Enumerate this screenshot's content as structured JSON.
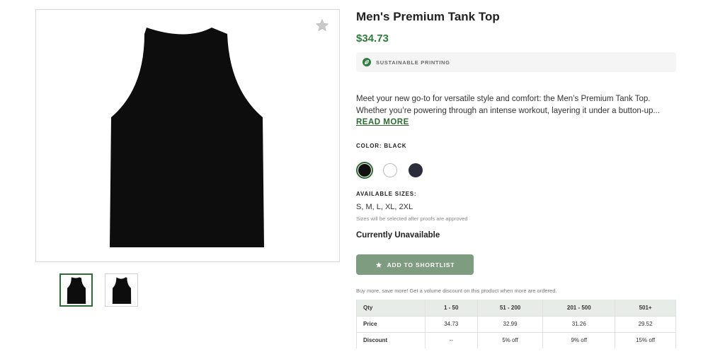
{
  "product": {
    "title": "Men's Premium Tank Top",
    "price": "$34.73",
    "badge": {
      "icon": "leaf-icon",
      "text": "SUSTAINABLE PRINTING"
    },
    "description_line1": "Meet your new go-to for versatile style and comfort: the Men’s Premium Tank Top.",
    "description_line2": "Whether you’re powering through an intense workout, layering it under a button-up...",
    "read_more": "READ MORE",
    "color_label": "COLOR: BLACK",
    "colors": [
      {
        "name": "Black",
        "hex": "#111111",
        "selected": true
      },
      {
        "name": "White",
        "hex": "#ffffff",
        "selected": false
      },
      {
        "name": "Navy",
        "hex": "#2b2d3a",
        "selected": false
      }
    ],
    "sizes_label": "AVAILABLE SIZES:",
    "sizes": "S, M, L, XL, 2XL",
    "sizes_note": "Sizes will be selected after proofs are approved",
    "availability": "Currently Unavailable",
    "shortlist_button": "ADD TO SHORTLIST",
    "volume_note": "Buy more, save more! Get a volume discount on this product when more are ordered."
  },
  "gallery": {
    "favorite_icon": "star-icon",
    "main_image": "black-tank-top-front",
    "thumbnails": [
      "black-tank-top-front",
      "black-tank-top-back"
    ]
  },
  "volume_table": {
    "headers": [
      "Qty",
      "1 - 50",
      "51 - 200",
      "201 - 500",
      "501+"
    ],
    "price_row": [
      "Price",
      "34.73",
      "32.99",
      "31.26",
      "29.52"
    ],
    "discount_row": [
      "Discount",
      "--",
      "5% off",
      "9% off",
      "15% off"
    ]
  },
  "colors": {
    "accent": "#2e7d3a",
    "button": "#7d9c80",
    "table_header": "#e8ece9"
  }
}
